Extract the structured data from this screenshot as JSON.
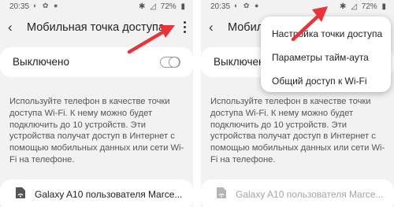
{
  "status_bar": {
    "time": "20:35",
    "battery": "72%"
  },
  "screen": {
    "title": "Мобильная точка доступа",
    "title_truncated": "Мобиль",
    "toggle_label": "Выключено",
    "toggle_state": "off",
    "description": "Используйте телефон в качестве точки доступа Wi-Fi. К нему можно будет подключить до 10 устройств. Эти устройства получат доступ в Интернет с помощью мобильных данных или сети Wi-Fi на телефоне.",
    "device_name": "Galaxy A10 пользователя Marce..."
  },
  "menu": {
    "items": [
      {
        "label": "Настройка точки доступа"
      },
      {
        "label": "Параметры тайм-аута"
      },
      {
        "label": "Общий доступ к Wi-Fi"
      }
    ]
  },
  "colors": {
    "background": "#f2f2f2",
    "card": "#ffffff",
    "annotation_arrow": "#e8333a"
  },
  "icons": {
    "back": "back-arrow-icon",
    "more": "more-vertical-icon",
    "device": "hotspot-device-icon",
    "annotation": "red-arrow"
  }
}
